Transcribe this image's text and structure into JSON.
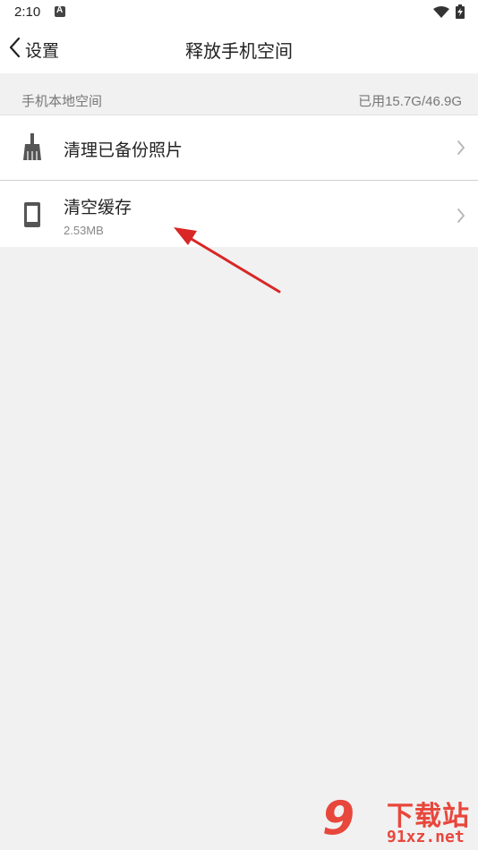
{
  "status_bar": {
    "time": "2:10",
    "notification_icon": "text-a-notification-icon",
    "wifi_icon": "wifi-icon",
    "battery_icon": "battery-charging-icon"
  },
  "nav": {
    "back_label": "设置",
    "back_icon": "chevron-left-icon",
    "title": "释放手机空间"
  },
  "section": {
    "title": "手机本地空间",
    "usage": "已用15.7G/46.9G"
  },
  "items": [
    {
      "icon": "broom-icon",
      "title": "清理已备份照片",
      "subtitle": ""
    },
    {
      "icon": "phone-icon",
      "title": "清空缓存",
      "subtitle": "2.53MB"
    }
  ],
  "watermark": {
    "logo": "9",
    "title": "下载站",
    "url": "91xz.net"
  },
  "colors": {
    "background": "#f1f1f1",
    "surface": "#ffffff",
    "secondary_text": "#888888",
    "annotation_arrow": "#d92626",
    "watermark": "#e8473c"
  }
}
